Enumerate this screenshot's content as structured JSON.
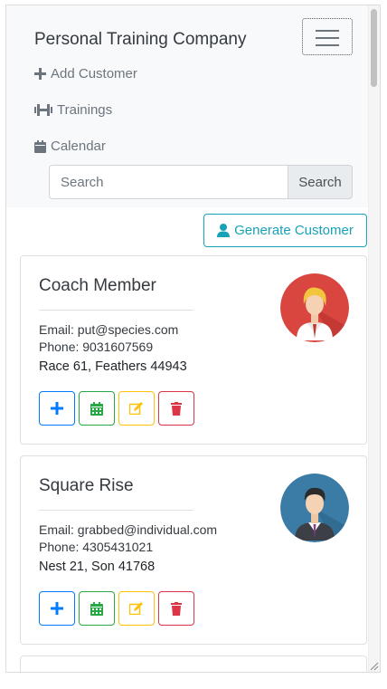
{
  "navbar": {
    "brand": "Personal Training Company",
    "items": [
      {
        "label": "Add Customer",
        "icon": "plus-icon"
      },
      {
        "label": "Trainings",
        "icon": "dumbbell-icon"
      },
      {
        "label": "Calendar",
        "icon": "calendar-icon"
      }
    ],
    "search": {
      "placeholder": "Search",
      "button_label": "Search"
    }
  },
  "generate_button_label": "Generate Customer",
  "customers": [
    {
      "name": "Coach Member",
      "email": "Email: put@species.com",
      "phone": "Phone: 9031607569",
      "address": "Race 61, Feathers 44943",
      "avatar": "female-avatar-icon"
    },
    {
      "name": "Square Rise",
      "email": "Email: grabbed@individual.com",
      "phone": "Phone: 4305431021",
      "address": "Nest 21, Son 41768",
      "avatar": "male-avatar-icon"
    }
  ],
  "colors": {
    "primary": "#007bff",
    "success": "#28a745",
    "warning": "#ffc107",
    "danger": "#dc3545",
    "info": "#17a2b8",
    "navbar_bg": "#f8f9fa"
  }
}
